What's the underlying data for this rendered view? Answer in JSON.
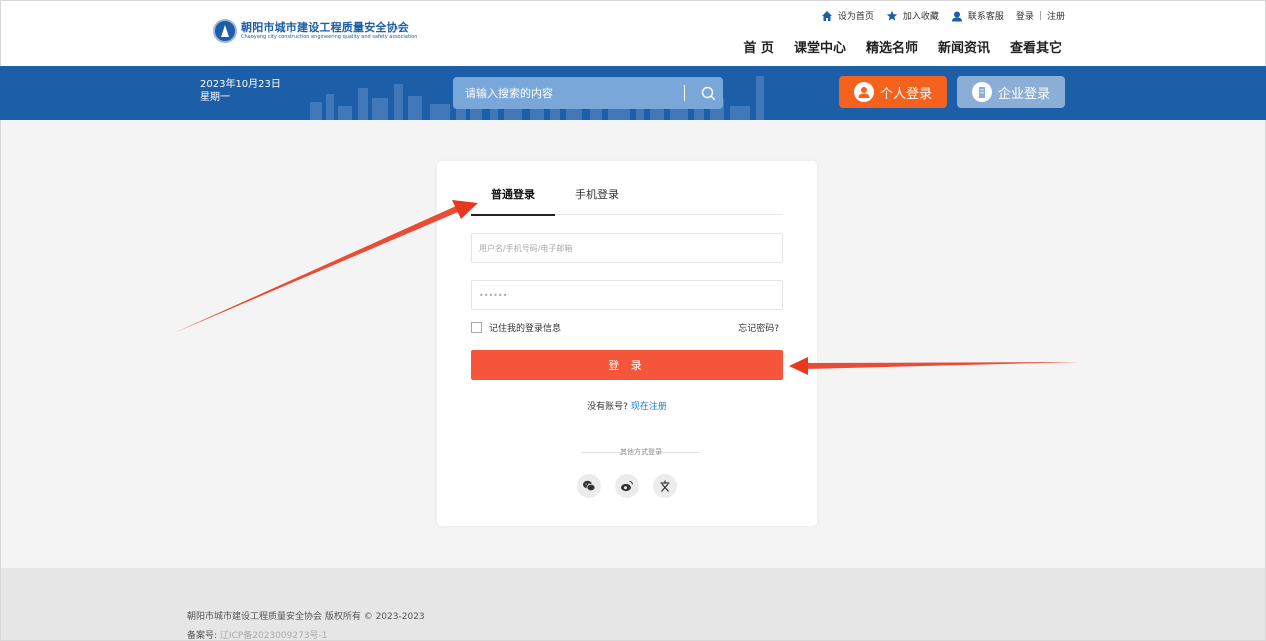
{
  "header": {
    "logo_cn": "朝阳市城市建设工程质量安全协会",
    "logo_en": "Chaoyang city construction engineering quality and safety association",
    "utility": {
      "set_home": "设为首页",
      "add_favorite": "加入收藏",
      "contact": "联系客服",
      "login": "登录",
      "separator": "|",
      "register": "注册"
    },
    "nav": [
      "首 页",
      "课堂中心",
      "精选名师",
      "新闻资讯",
      "查看其它"
    ]
  },
  "banner": {
    "date": "2023年10月23日",
    "weekday": "星期一",
    "search_placeholder": "请输入搜索的内容",
    "personal_login": "个人登录",
    "company_login": "企业登录"
  },
  "login": {
    "tabs": [
      "普通登录",
      "手机登录"
    ],
    "active_tab": 0,
    "username_placeholder": "用户名/手机号码/电子邮箱",
    "password_placeholder": "••••••",
    "remember_label": "记住我的登录信息",
    "forgot_label": "忘记密码?",
    "submit_label": "登 录",
    "no_account": "没有账号?",
    "register_now": "现在注册",
    "other_methods": "其他方式登录",
    "social_icons": [
      "wechat-icon",
      "weibo-icon",
      "wenku-icon"
    ],
    "submit_color": "#f5553a"
  },
  "footer": {
    "copyright": "朝阳市城市建设工程质量安全协会 版权所有 © 2023-2023",
    "icp_label": "备案号:",
    "icp_number": "辽ICP备2023009273号-1"
  },
  "colors": {
    "brand_blue": "#1d5ea8",
    "orange": "#f5621e",
    "annotation_red": "#e8391f"
  }
}
